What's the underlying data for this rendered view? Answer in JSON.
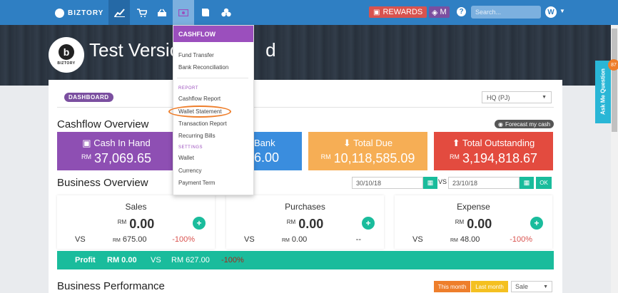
{
  "brand": "BIZTORY",
  "nav": {
    "icons": [
      "chart-icon",
      "cart-icon",
      "basket-icon",
      "cashflow-icon",
      "book-icon",
      "cubes-icon"
    ],
    "rewards_label": "REWARDS",
    "badge_label": "M",
    "help_label": "?",
    "search_placeholder": "Search...",
    "avatar_letter": "W"
  },
  "hero": {
    "company": "Test Versio",
    "company_tail": "d",
    "logo_letter": "b",
    "logo_text": "BIZTORY"
  },
  "dashboard": {
    "badge": "DASHBOARD",
    "branch": "HQ (PJ)"
  },
  "cashflow": {
    "title": "Cashflow Overview",
    "forecast": "Forecast my cash",
    "cards": [
      {
        "label": "Cash In Hand",
        "currency": "RM",
        "value": "37,069.65",
        "color": "#8e4fb3"
      },
      {
        "label": "Bank",
        "currency": "",
        "value": "6.00",
        "color": "#3a8dde"
      },
      {
        "label": "Total Due",
        "currency": "RM",
        "value": "10,118,585.09",
        "color": "#f6ae55"
      },
      {
        "label": "Total Outstanding",
        "currency": "RM",
        "value": "3,194,818.67",
        "color": "#e34b3f"
      }
    ]
  },
  "business": {
    "title": "Business Overview",
    "date_from": "30/10/18",
    "vs": "VS",
    "date_to": "23/10/18",
    "ok": "OK",
    "boxes": [
      {
        "title": "Sales",
        "currency": "RM",
        "value": "0.00",
        "vs": "VS",
        "cmp_currency": "RM",
        "cmp_value": "675.00",
        "pct": "-100%"
      },
      {
        "title": "Purchases",
        "currency": "RM",
        "value": "0.00",
        "vs": "VS",
        "cmp_currency": "RM",
        "cmp_value": "0.00",
        "pct": "--"
      },
      {
        "title": "Expense",
        "currency": "RM",
        "value": "0.00",
        "vs": "VS",
        "cmp_currency": "RM",
        "cmp_value": "48.00",
        "pct": "-100%"
      }
    ],
    "profit": {
      "label": "Profit",
      "value": "RM 0.00",
      "vs": "VS",
      "cmp": "RM 627.00",
      "pct": "-100%"
    }
  },
  "performance": {
    "title": "Business Performance",
    "this_month": "This month",
    "last_month": "Last month",
    "select": "Sale"
  },
  "dropdown": {
    "header": "CASHFLOW",
    "items_top": [
      "Fund Transfer",
      "Bank Reconciliation"
    ],
    "report_heading": "REPORT",
    "report_items": [
      "Cashflow Report",
      "Wallet Statement",
      "Transaction Report",
      "Recurring Bills"
    ],
    "settings_heading": "SETTINGS",
    "settings_items": [
      "Wallet",
      "Currency",
      "Payment Term"
    ]
  },
  "side": {
    "ask": "Ask Me Question",
    "notif": "87"
  }
}
